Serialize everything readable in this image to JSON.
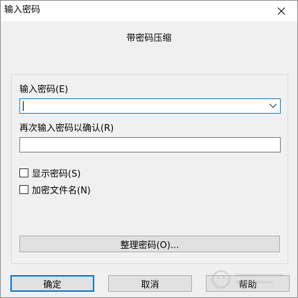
{
  "window": {
    "title": "输入密码"
  },
  "heading": "带密码压缩",
  "password": {
    "label": "输入密码(E)",
    "value": ""
  },
  "confirm": {
    "label": "再次输入密码以确认(R)",
    "value": ""
  },
  "options": [
    {
      "label": "显示密码(S)",
      "checked": false
    },
    {
      "label": "加密文件名(N)",
      "checked": false
    }
  ],
  "buttons": {
    "organize": "整理密码(O)...",
    "ok": "确定",
    "cancel": "取消",
    "help": "帮助"
  },
  "icons": {
    "close": "close-icon",
    "dropdown": "chevron-down-icon"
  },
  "colors": {
    "accent": "#0078d7"
  }
}
